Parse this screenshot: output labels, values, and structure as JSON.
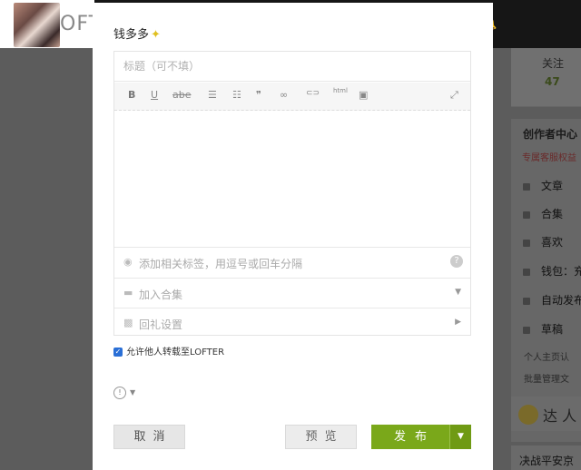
{
  "background": {
    "logo_text": "OFT",
    "follow_label": "关注",
    "follow_count": "47",
    "creator_center": {
      "title": "创作者中心",
      "vip": "专属客服权益",
      "items": [
        "文章",
        "合集",
        "喜欢",
        "钱包：充",
        "自动发布",
        "草稿"
      ],
      "small_items": [
        "个人主页认",
        "批量管理文"
      ]
    },
    "daren": "达 人",
    "battle": "决战平安京"
  },
  "modal": {
    "author": "钱多多",
    "title_placeholder": "标题（可不填）",
    "toolbar": {
      "bold": "B",
      "underline": "U",
      "strike": "abe",
      "ul": "☰",
      "ol": "☷",
      "quote": "❞",
      "link": "∞",
      "unlink": "⊂⊃",
      "html": "html",
      "image": "▣",
      "fullscreen": "⤢"
    },
    "tag_placeholder": "添加相关标签，用逗号或回车分隔",
    "collection_label": "加入合集",
    "gift_label": "回礼设置",
    "repost_label": "允许他人转载至LOFTER",
    "repost_checked": true,
    "buttons": {
      "cancel": "取消",
      "preview": "预览",
      "publish": "发布"
    }
  },
  "colors": {
    "publish": "#7aa81a",
    "checkbox": "#2a6fd6"
  }
}
